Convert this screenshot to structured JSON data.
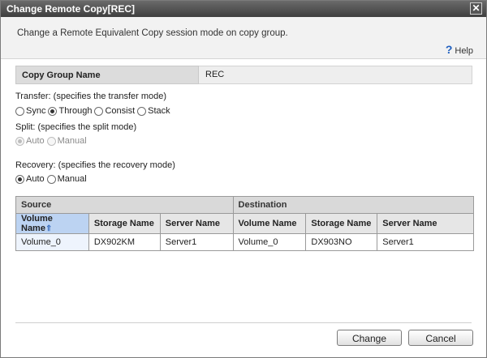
{
  "window": {
    "title": "Change Remote Copy[REC]",
    "close_glyph": "✕"
  },
  "description": "Change a Remote Equivalent Copy session mode on copy group.",
  "help": {
    "label": "Help",
    "icon": "question-mark-icon"
  },
  "copy_group": {
    "label": "Copy Group Name",
    "value": "REC"
  },
  "transfer": {
    "label": "Transfer: (specifies the transfer mode)",
    "options": [
      {
        "label": "Sync",
        "selected": false
      },
      {
        "label": "Through",
        "selected": true
      },
      {
        "label": "Consist",
        "selected": false
      },
      {
        "label": "Stack",
        "selected": false
      }
    ]
  },
  "split": {
    "label": "Split: (specifies the split mode)",
    "disabled": true,
    "options": [
      {
        "label": "Auto",
        "selected": true
      },
      {
        "label": "Manual",
        "selected": false
      }
    ]
  },
  "recovery": {
    "label": "Recovery: (specifies the recovery mode)",
    "options": [
      {
        "label": "Auto",
        "selected": true
      },
      {
        "label": "Manual",
        "selected": false
      }
    ]
  },
  "table": {
    "groups": [
      "Source",
      "Destination"
    ],
    "columns": [
      "Volume Name",
      "Storage Name",
      "Server Name",
      "Volume Name",
      "Storage Name",
      "Server Name"
    ],
    "sort_glyph": "⇑",
    "rows": [
      [
        "Volume_0",
        "DX902KM",
        "Server1",
        "Volume_0",
        "DX903NO",
        "Server1"
      ]
    ]
  },
  "buttons": {
    "change": "Change",
    "cancel": "Cancel"
  }
}
